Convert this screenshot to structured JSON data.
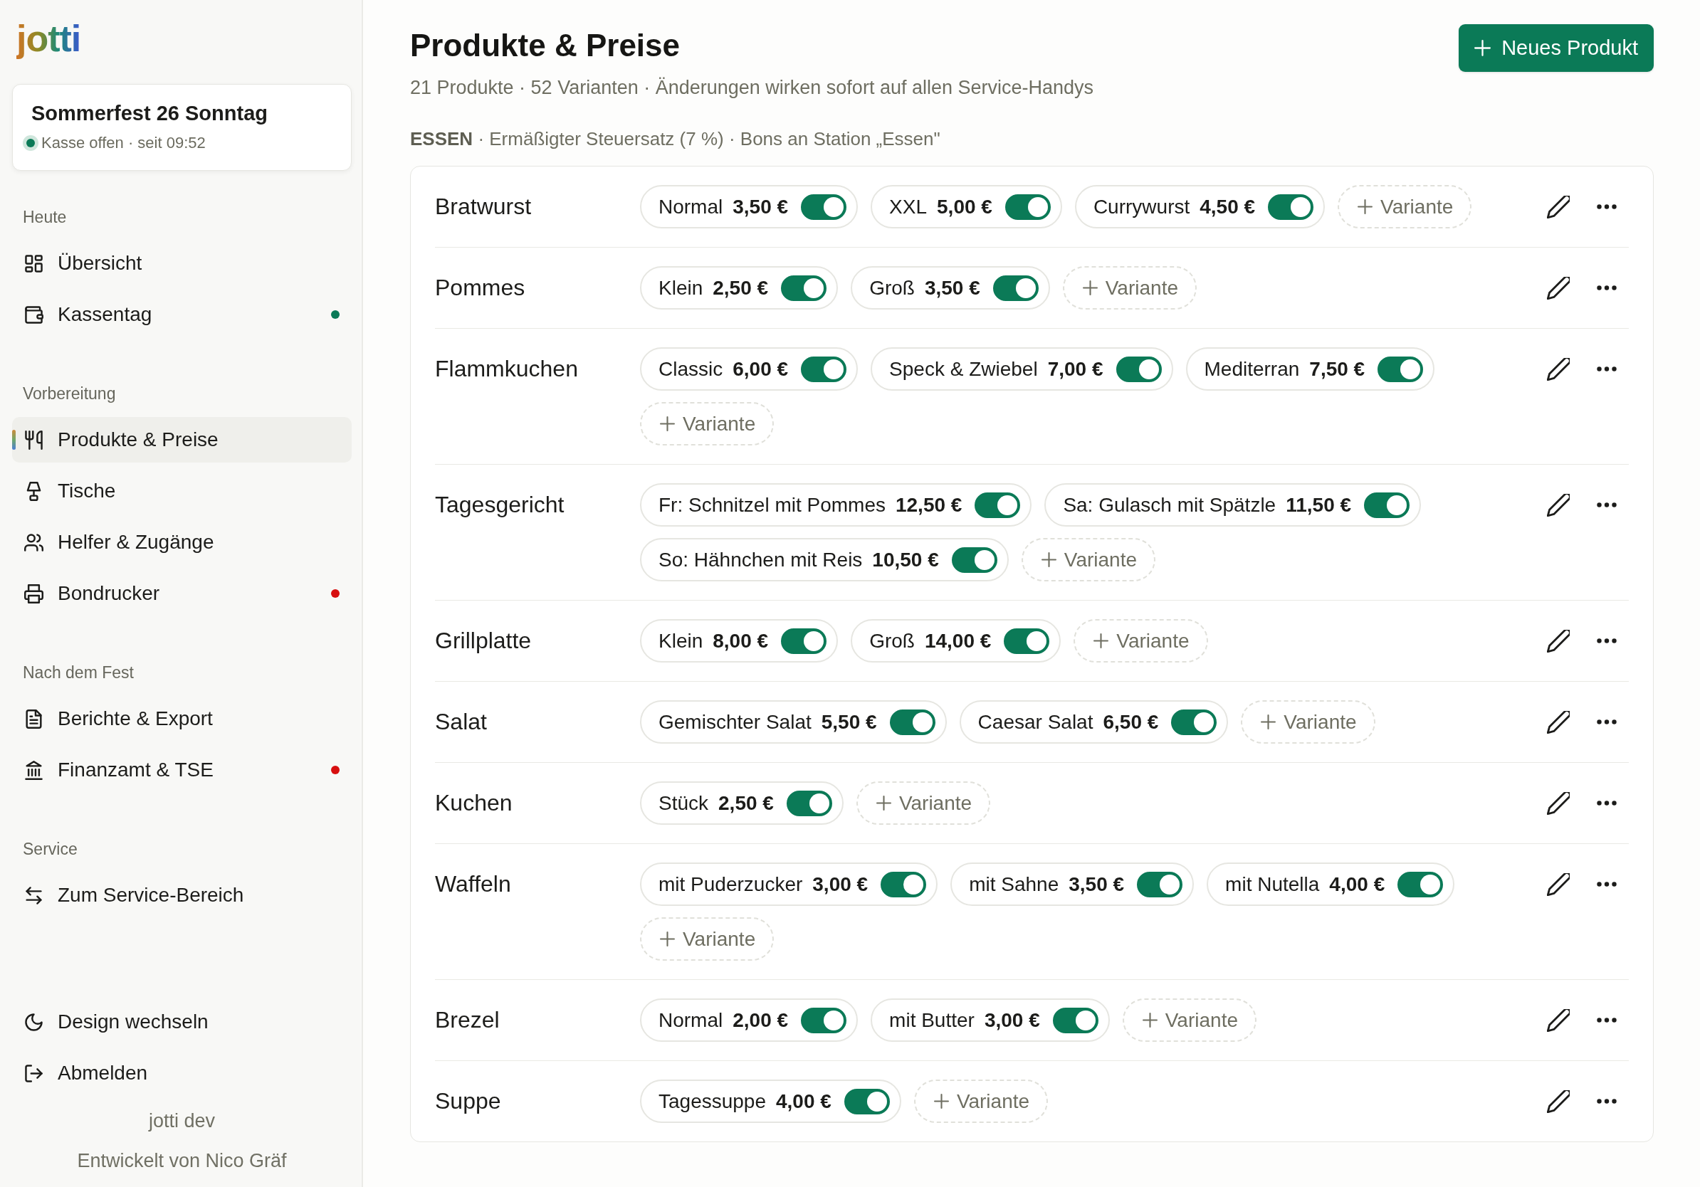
{
  "sidebar": {
    "logo": "jotti",
    "event": {
      "title": "Sommerfest 26 Sonntag",
      "status": "Kasse offen · seit 09:52",
      "open": true
    },
    "sections": [
      {
        "label": "Heute",
        "items": [
          {
            "label": "Übersicht",
            "selected": false
          },
          {
            "label": "Kassentag",
            "selected": false,
            "color": "#0b7a57"
          }
        ]
      },
      {
        "label": "Vorbereitung",
        "items": [
          {
            "label": "Produkte & Preise",
            "selected": true
          },
          {
            "label": "Tische",
            "selected": false
          },
          {
            "label": "Helfer & Zugänge",
            "selected": false
          },
          {
            "label": "Bondrucker",
            "selected": false,
            "color": "#d70f0f"
          }
        ]
      },
      {
        "label": "Nach dem Fest",
        "items": [
          {
            "label": "Berichte & Export",
            "selected": false
          },
          {
            "label": "Finanzamt & TSE",
            "selected": false,
            "color": "#d70f0f"
          }
        ]
      },
      {
        "label": "Service",
        "items": [
          {
            "label": "Zum Service-Bereich",
            "selected": false
          }
        ]
      }
    ],
    "footer_items": [
      "Design wechseln",
      "Abmelden"
    ],
    "version": "jotti dev",
    "credit": "Entwickelt von Nico Gräf"
  },
  "header": {
    "title": "Produkte & Preise",
    "subtitle": "21 Produkte · 52 Varianten · Änderungen wirken sofort auf allen Service-Handys",
    "new_button": "Neues Produkt"
  },
  "category": "**ESSEN** · Ermäßigter Steuersatz (7 %) · Bons an Station „Essen\"",
  "products": [
    {
      "name": "Bratwurst",
      "variants": [
        {
          "name": "Normal",
          "price": "3,50 €",
          "on": true
        },
        {
          "name": "XXL",
          "price": "5,00 €",
          "on": true
        },
        {
          "name": "Currywurst",
          "price": "4,50 €",
          "on": true
        }
      ],
      "add_variant": "Variante"
    },
    {
      "name": "Pommes",
      "variants": [
        {
          "name": "Klein",
          "price": "2,50 €",
          "on": true
        },
        {
          "name": "Groß",
          "price": "3,50 €",
          "on": true
        }
      ],
      "add_variant": "Variante"
    },
    {
      "name": "Flammkuchen",
      "variants": [
        {
          "name": "Classic",
          "price": "6,00 €",
          "on": true
        },
        {
          "name": "Speck & Zwiebel",
          "price": "7,00 €",
          "on": true
        },
        {
          "name": "Mediterran",
          "price": "7,50 €",
          "on": true
        }
      ],
      "add_variant": "Variante"
    },
    {
      "name": "Tagesgericht",
      "variants": [
        {
          "name": "Fr: Schnitzel mit Pommes",
          "price": "12,50 €",
          "on": true
        },
        {
          "name": "Sa: Gulasch mit Spätzle",
          "price": "11,50 €",
          "on": true
        },
        {
          "name": "So: Hähnchen mit Reis",
          "price": "10,50 €",
          "on": true
        }
      ],
      "add_variant": "Variante"
    },
    {
      "name": "Grillplatte",
      "variants": [
        {
          "name": "Klein",
          "price": "8,00 €",
          "on": true
        },
        {
          "name": "Groß",
          "price": "14,00 €",
          "on": true
        }
      ],
      "add_variant": "Variante"
    },
    {
      "name": "Salat",
      "variants": [
        {
          "name": "Gemischter Salat",
          "price": "5,50 €",
          "on": true
        },
        {
          "name": "Caesar Salat",
          "price": "6,50 €",
          "on": true
        }
      ],
      "add_variant": "Variante"
    },
    {
      "name": "Kuchen",
      "variants": [
        {
          "name": "Stück",
          "price": "2,50 €",
          "on": true
        }
      ],
      "add_variant": "Variante"
    },
    {
      "name": "Waffeln",
      "variants": [
        {
          "name": "mit Puderzucker",
          "price": "3,00 €",
          "on": true
        },
        {
          "name": "mit Sahne",
          "price": "3,50 €",
          "on": true
        },
        {
          "name": "mit Nutella",
          "price": "4,00 €",
          "on": true
        }
      ],
      "add_variant": "Variante"
    },
    {
      "name": "Brezel",
      "variants": [
        {
          "name": "Normal",
          "price": "2,00 €",
          "on": true
        },
        {
          "name": "mit Butter",
          "price": "3,00 €",
          "on": true
        }
      ],
      "add_variant": "Variante"
    },
    {
      "name": "Suppe",
      "variants": [
        {
          "name": "Tagessuppe",
          "price": "4,00 €",
          "on": true
        }
      ],
      "add_variant": "Variante"
    }
  ]
}
